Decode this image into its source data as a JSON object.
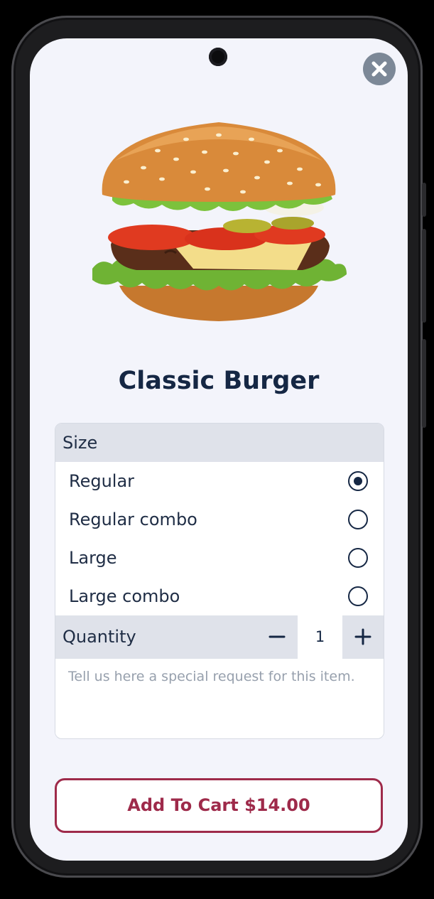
{
  "product": {
    "name": "Classic Burger",
    "image": "burger-image"
  },
  "size": {
    "header": "Size",
    "options": [
      {
        "label": "Regular",
        "selected": true
      },
      {
        "label": "Regular combo",
        "selected": false
      },
      {
        "label": "Large",
        "selected": false
      },
      {
        "label": "Large combo",
        "selected": false
      }
    ]
  },
  "quantity": {
    "label": "Quantity",
    "value": "1",
    "minus_icon": "minus-icon",
    "plus_icon": "plus-icon"
  },
  "request": {
    "placeholder": "Tell us here a special request for this item."
  },
  "cart": {
    "button_label": "Add To Cart $14.00"
  },
  "icons": {
    "close": "close-icon"
  },
  "colors": {
    "primary": "#152744",
    "accent": "#9e2a4a",
    "background": "#f3f4fb",
    "section": "#dfe2ea"
  }
}
